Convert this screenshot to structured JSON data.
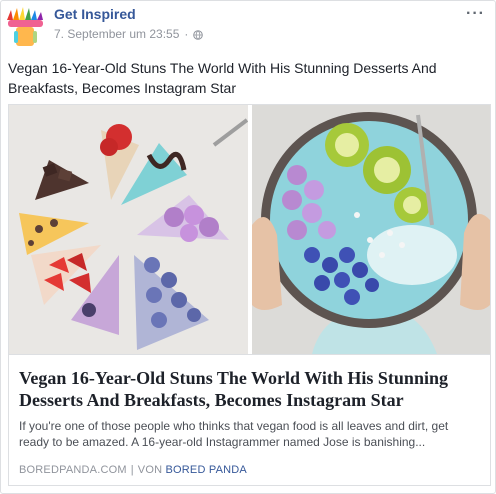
{
  "header": {
    "page_name": "Get Inspired",
    "timestamp": "7. September um 23:55",
    "separator": "·",
    "privacy_icon": "globe-icon",
    "more_label": "···"
  },
  "post": {
    "text": "Vegan 16-Year-Old Stuns The World With His Stunning Desserts And Breakfasts, Becomes Instagram Star"
  },
  "link_card": {
    "title": "Vegan 16-Year-Old Stuns The World With His Stunning Desserts And Breakfasts, Becomes Instagram Star",
    "description": "If you're one of those people who thinks that vegan food is all leaves and dirt, get ready to be amazed. A 16-year-old Instagrammer named Jose is banishing...",
    "domain": "BOREDPANDA.COM",
    "separator": "|",
    "by_prefix": "VON",
    "by_name": "BORED PANDA"
  },
  "colors": {
    "link_blue": "#365899",
    "meta_gray": "#90949c",
    "text_dark": "#1d2129"
  }
}
